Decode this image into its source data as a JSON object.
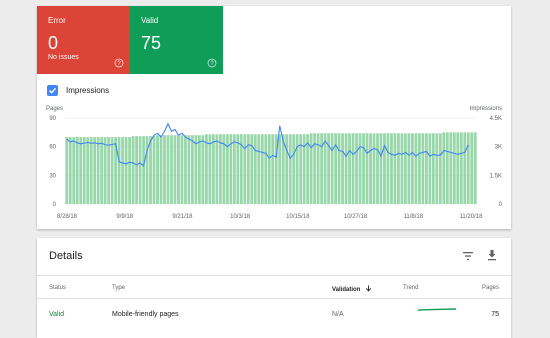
{
  "summary": {
    "error": {
      "label": "Error",
      "count": "0",
      "sub": "No issues",
      "color": "#db4437"
    },
    "valid": {
      "label": "Valid",
      "count": "75",
      "color": "#0f9d58"
    }
  },
  "impressions_toggle": {
    "label": "Impressions",
    "checked": true
  },
  "chart_data": {
    "type": "bar",
    "left_axis_title": "Pages",
    "right_axis_title": "Impressions",
    "y_left_ticks": [
      "90",
      "60",
      "30",
      "0"
    ],
    "y_right_ticks": [
      "4.5K",
      "3K",
      "1.5K",
      "0"
    ],
    "ylim_left": [
      0,
      90
    ],
    "ylim_right": [
      0,
      4500
    ],
    "x_ticks": [
      "8/28/18",
      "9/9/18",
      "9/21/18",
      "10/3/18",
      "10/15/18",
      "10/27/18",
      "11/8/18",
      "11/20/18"
    ],
    "grid": true,
    "series": [
      {
        "name": "Pages",
        "color": "#97d7aa",
        "values": [
          70,
          70,
          70,
          70,
          70,
          70,
          70,
          70,
          70,
          70,
          70,
          70,
          70,
          70,
          70,
          70,
          70,
          70,
          70,
          71,
          71,
          71,
          71,
          71,
          71,
          71,
          72,
          72,
          72,
          72,
          72,
          72,
          72,
          72,
          72,
          72,
          72,
          72,
          72,
          72,
          73,
          73,
          73,
          73,
          73,
          73,
          73,
          73,
          73,
          73,
          73,
          73,
          73,
          73,
          73,
          73,
          73,
          73,
          73,
          73,
          73,
          73,
          73,
          73,
          73,
          73,
          73,
          73,
          73,
          73,
          74,
          74,
          74,
          74,
          74,
          74,
          74,
          74,
          74,
          74,
          74,
          74,
          74,
          74,
          74,
          74,
          74,
          74,
          74,
          74,
          74,
          74,
          74,
          74,
          74,
          74,
          74,
          74,
          74,
          74,
          74,
          74,
          74,
          74,
          74,
          74,
          74,
          74,
          75,
          75,
          75,
          75,
          75,
          75,
          75,
          75,
          75,
          75
        ]
      },
      {
        "name": "Impressions",
        "color": "#4285f4",
        "values": [
          3400,
          3250,
          3300,
          3200,
          3150,
          3180,
          3220,
          3180,
          3200,
          3150,
          3180,
          3100,
          3080,
          3120,
          3150,
          2200,
          2150,
          2100,
          2180,
          2150,
          2050,
          2150,
          2000,
          2800,
          3300,
          3600,
          3700,
          3500,
          3800,
          4200,
          3800,
          3900,
          3600,
          3700,
          3500,
          3400,
          3300,
          3150,
          3250,
          3300,
          3200,
          3150,
          3250,
          3300,
          3200,
          3150,
          3000,
          3150,
          3250,
          3200,
          3100,
          2900,
          3100,
          3050,
          2800,
          2750,
          2700,
          2650,
          2400,
          2550,
          2450,
          4100,
          3300,
          2800,
          2400,
          2600,
          3000,
          3100,
          3000,
          3200,
          2950,
          3150,
          3100,
          3000,
          3300,
          3050,
          2800,
          3100,
          2800,
          2750,
          2500,
          2800,
          2600,
          2750,
          3000,
          2950,
          2650,
          2800,
          2900,
          2850,
          2500,
          3050,
          2700,
          2600,
          2550,
          2650,
          2600,
          2700,
          2550,
          2700,
          2500,
          2650,
          2700,
          2750,
          2500,
          2600,
          2550,
          2550,
          2800,
          2750,
          2700,
          2650,
          2600,
          2650,
          2700,
          3100
        ]
      }
    ]
  },
  "details": {
    "title": "Details",
    "columns": {
      "status": "Status",
      "type": "Type",
      "validation": "Validation",
      "trend": "Trend",
      "pages": "Pages"
    },
    "rows": [
      {
        "status": "Valid",
        "type": "Mobile-friendly pages",
        "validation": "N/A",
        "pages": "75",
        "status_color": "#188038",
        "trend_color": "#0f9d58"
      }
    ]
  },
  "icons": {
    "help": "help-circle-icon",
    "check": "check-icon",
    "filter": "filter-icon",
    "download": "download-icon",
    "sort": "arrow-down-icon"
  }
}
